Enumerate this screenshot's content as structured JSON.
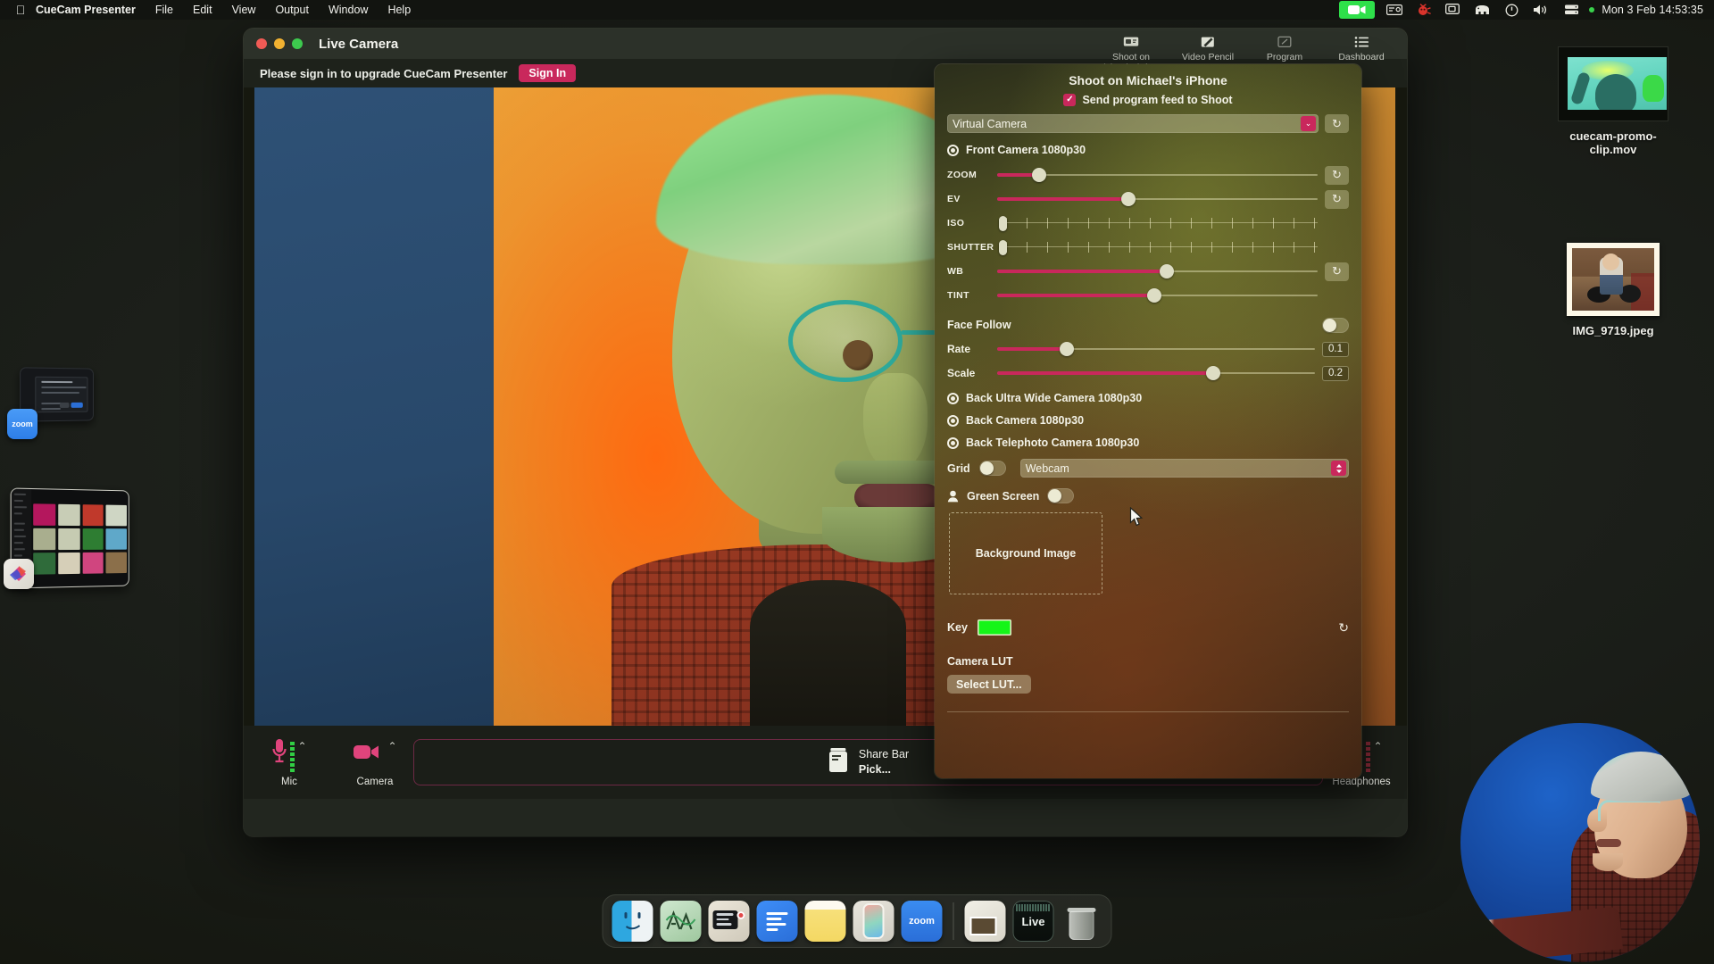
{
  "menubar": {
    "apple_icon": "apple-logo",
    "app_name": "CueCam Presenter",
    "items": [
      "File",
      "Edit",
      "View",
      "Output",
      "Window",
      "Help"
    ],
    "status_icons": [
      "camera-badge-icon",
      "ticket-icon",
      "bug-icon",
      "screen-mirroring-icon",
      "mastodon-elephant-icon",
      "clock-info-icon",
      "volume-icon",
      "server-icon"
    ],
    "clock": "Mon 3 Feb  14:53:35"
  },
  "desktop": {
    "icons": [
      {
        "label": "cuecam-promo-clip.mov",
        "type": "movie-file"
      },
      {
        "label": "IMG_9719.jpeg",
        "type": "image-file"
      }
    ],
    "minimized": [
      {
        "name": "zoom-meeting-window",
        "badge": "zoom"
      },
      {
        "name": "browser-video-grid-window",
        "badge": "app"
      }
    ]
  },
  "window": {
    "title": "Live Camera",
    "traffic_lights": [
      "close",
      "minimize",
      "zoom"
    ],
    "toolbar": [
      {
        "label": "Shoot on Michael's iPhone",
        "icon": "device-capture-icon"
      },
      {
        "label": "Video Pencil",
        "icon": "pencil-screen-icon"
      },
      {
        "label": "Program",
        "icon": "program-icon"
      },
      {
        "label": "Dashboard",
        "icon": "list-dashboard-icon"
      }
    ],
    "signin": {
      "message": "Please sign in to upgrade CueCam Presenter",
      "button": "Sign In"
    },
    "bottom_bar": {
      "mic_label": "Mic",
      "camera_label": "Camera",
      "share_title": "Share Bar",
      "share_action": "Pick...",
      "headphones_label": "Headphones",
      "chevron": "⌃"
    }
  },
  "shoot_panel": {
    "title": "Shoot on Michael's iPhone",
    "send_feed_label": "Send program feed to Shoot",
    "send_feed_checked": true,
    "source_select": {
      "value": "Virtual Camera",
      "chevron": "⌄"
    },
    "refresh_icon": "↻",
    "front_camera": "Front Camera 1080p30",
    "sliders": [
      {
        "label": "ZOOM",
        "fill_pct": 13,
        "knob_pct": 13,
        "reset": true,
        "value": null
      },
      {
        "label": "EV",
        "fill_pct": 41,
        "knob_pct": 41,
        "reset": true,
        "value": null
      },
      {
        "label": "WB",
        "fill_pct": 53,
        "knob_pct": 53,
        "reset": true,
        "value": null
      },
      {
        "label": "TINT",
        "fill_pct": 49,
        "knob_pct": 49,
        "reset": false,
        "value": null
      }
    ],
    "tick_sliders": [
      {
        "label": "ISO"
      },
      {
        "label": "SHUTTER"
      }
    ],
    "face_follow": {
      "label": "Face Follow",
      "on": false
    },
    "rate": {
      "label": "Rate",
      "value": "0.1",
      "fill_pct": 22
    },
    "scale": {
      "label": "Scale",
      "value": "0.2",
      "fill_pct": 68
    },
    "other_cameras": [
      "Back Ultra Wide Camera 1080p30",
      "Back Camera 1080p30",
      "Back Telephoto Camera 1080p30"
    ],
    "grid": {
      "label": "Grid",
      "on": false
    },
    "grid_select": {
      "value": "Webcam",
      "stepper": "⌃⌄"
    },
    "green_screen": {
      "label": "Green Screen",
      "on": false,
      "icon": "person-icon"
    },
    "background_dropzone": "Background Image",
    "key": {
      "label": "Key",
      "color": "#15f518",
      "reset_icon": "↻"
    },
    "camera_lut": {
      "heading": "Camera LUT",
      "button": "Select LUT..."
    }
  },
  "colors": {
    "accent_pink": "#c9285c",
    "key_green": "#15f518",
    "menubar_green": "#2ee04a"
  },
  "dock": {
    "items": [
      {
        "name": "finder",
        "running": true
      },
      {
        "name": "audio-app",
        "running": true
      },
      {
        "name": "cuecam",
        "running": true
      },
      {
        "name": "document-app",
        "running": false
      },
      {
        "name": "notes",
        "running": false
      },
      {
        "name": "iphone-mirroring",
        "running": false
      },
      {
        "name": "zoom",
        "running": true
      },
      {
        "name": "recent-file",
        "running": false
      },
      {
        "name": "live-app",
        "running": false,
        "label": "Live"
      },
      {
        "name": "trash",
        "running": false
      }
    ]
  }
}
